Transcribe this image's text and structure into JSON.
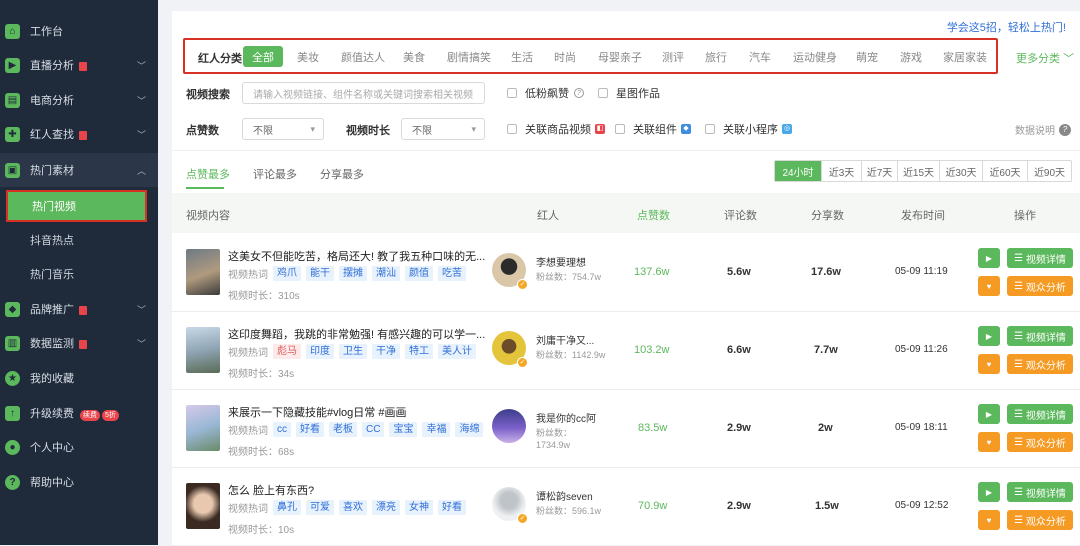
{
  "sidebar": {
    "items": [
      {
        "label": "工作台",
        "icon": "home-icon"
      },
      {
        "label": "直播分析",
        "icon": "live-icon"
      },
      {
        "label": "电商分析",
        "icon": "cart-icon"
      },
      {
        "label": "红人查找",
        "icon": "puzzle-icon"
      },
      {
        "label": "热门素材",
        "icon": "tv-icon"
      },
      {
        "label": "品牌推广",
        "icon": "cube-icon"
      },
      {
        "label": "数据监测",
        "icon": "chart-icon"
      },
      {
        "label": "我的收藏",
        "icon": "star-icon"
      },
      {
        "label": "升级续费",
        "icon": "upgrade-icon"
      },
      {
        "label": "个人中心",
        "icon": "user-icon"
      },
      {
        "label": "帮助中心",
        "icon": "help-icon"
      }
    ],
    "subitems": [
      "热门视频",
      "抖音热点",
      "热门音乐"
    ],
    "renew_tags": [
      "续费",
      "5折"
    ]
  },
  "header": {
    "learn_link": "学会这5招，轻松上热门!"
  },
  "filters": {
    "category_label": "红人分类",
    "categories": [
      "全部",
      "美妆",
      "颜值达人",
      "美食",
      "剧情搞笑",
      "生活",
      "时尚",
      "母婴亲子",
      "测评",
      "旅行",
      "汽车",
      "运动健身",
      "萌宠",
      "游戏",
      "家居家装"
    ],
    "more_categories": "更多分类",
    "search_label": "视频搜索",
    "search_placeholder": "请输入视频链接、组件名称或关键词搜索相关视频",
    "low_fans": "低粉飙赞",
    "star_works": "星图作品",
    "likes_label": "点赞数",
    "likes_value": "不限",
    "duration_label": "视频时长",
    "duration_value": "不限",
    "linked_product": "关联商品视频",
    "linked_component": "关联组件",
    "linked_miniapp": "关联小程序",
    "data_help": "数据说明"
  },
  "sort_tabs": [
    "点赞最多",
    "评论最多",
    "分享最多"
  ],
  "time_ranges": [
    "24小时",
    "近3天",
    "近7天",
    "近15天",
    "近30天",
    "近60天",
    "近90天"
  ],
  "columns": [
    "视频内容",
    "红人",
    "点赞数",
    "评论数",
    "分享数",
    "发布时间",
    "操作"
  ],
  "hotword_label": "视频热词",
  "duration_prefix": "视频时长：",
  "fans_prefix": "粉丝数：",
  "actions": {
    "detail": "视频详情",
    "audience": "观众分析"
  },
  "videos": [
    {
      "title": "这美女不但能吃苦，格局还大! 教了我五种口味的无...",
      "hotwords": [
        "鸡爪",
        "能干",
        "摆摊",
        "潮汕",
        "颜值",
        "吃苦"
      ],
      "duration": "310s",
      "kol": "李想要理想",
      "fans": "754.7w",
      "likes": "137.6w",
      "comments": "5.6w",
      "shares": "17.6w",
      "time": "05-09 11:19"
    },
    {
      "title": "这印度舞蹈，我跳的非常勉强! 有感兴趣的可以学一...",
      "hotwords": [
        "彪马",
        "印度",
        "卫生",
        "干净",
        "特工",
        "美人计"
      ],
      "duration": "34s",
      "kol": "刘庸干净又...",
      "fans": "1142.9w",
      "likes": "103.2w",
      "comments": "6.6w",
      "shares": "7.7w",
      "time": "05-09 11:26"
    },
    {
      "title": "来展示一下隐藏技能#vlog日常 #画画",
      "hotwords": [
        "cc",
        "好看",
        "老板",
        "CC",
        "宝宝",
        "幸福",
        "海绵"
      ],
      "duration": "68s",
      "kol": "我是你的cc阿",
      "fans": "1734.9w",
      "likes": "83.5w",
      "comments": "2.9w",
      "shares": "2w",
      "time": "05-09 18:11"
    },
    {
      "title": "怎么 脸上有东西?",
      "hotwords": [
        "鼻孔",
        "可爱",
        "喜欢",
        "漂亮",
        "女神",
        "好看"
      ],
      "duration": "10s",
      "kol": "谭松韵seven",
      "fans": "596.1w",
      "likes": "70.9w",
      "comments": "2.9w",
      "shares": "1.5w",
      "time": "05-09 12:52"
    }
  ],
  "colors": {
    "accent": "#5cb85c",
    "orange": "#f59a23",
    "sidebar_bg": "#1f2a3a",
    "highlight_border": "#d93025"
  }
}
